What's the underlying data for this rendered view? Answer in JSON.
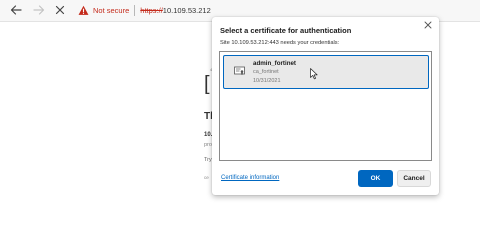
{
  "browser": {
    "security_label": "Not secure",
    "url_scheme": "https://",
    "url_host": "10.109.53.212"
  },
  "background_page": {
    "bracket": "[",
    "tiny_text": "4",
    "heading": "Th",
    "bold_line": "10.",
    "line1": "pro",
    "line2": "Try",
    "line3": "ce"
  },
  "dialog": {
    "title": "Select a certificate for authentication",
    "subtitle": "Site 10.109.53.212:443 needs your credentials:",
    "certificates": [
      {
        "name": "admin_fortinet",
        "issuer": "ca_fortinet",
        "date": "10/31/2021",
        "selected": true
      }
    ],
    "cert_info_link": "Certificate information",
    "ok_label": "OK",
    "cancel_label": "Cancel"
  },
  "colors": {
    "accent": "#0067c0",
    "warning": "#c42b1c",
    "selected_bg": "#e9e9e9"
  },
  "icons": {
    "back": "arrow-left-icon",
    "forward": "arrow-right-icon",
    "stop": "close-icon",
    "security": "warning-triangle-icon",
    "dialog_close": "close-icon",
    "certificate": "certificate-icon",
    "cursor": "mouse-cursor-icon"
  }
}
